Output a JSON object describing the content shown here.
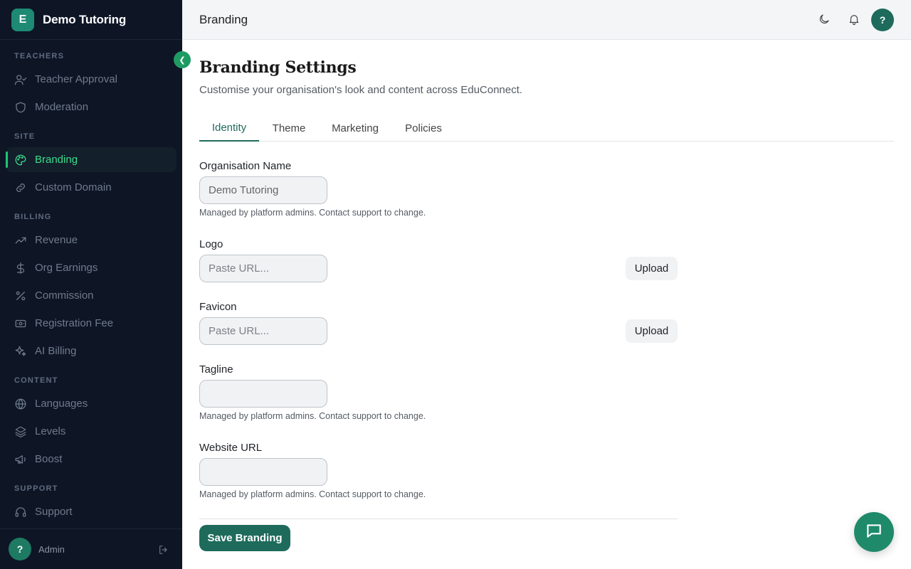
{
  "sidebar": {
    "brand_initial": "E",
    "brand_name": "Demo Tutoring",
    "sections": {
      "teachers": "TEACHERS",
      "site": "SITE",
      "billing": "BILLING",
      "content": "CONTENT",
      "support": "SUPPORT"
    },
    "items": {
      "teacher_approval": "Teacher Approval",
      "moderation": "Moderation",
      "branding": "Branding",
      "custom_domain": "Custom Domain",
      "revenue": "Revenue",
      "org_earnings": "Org Earnings",
      "commission": "Commission",
      "registration_fee": "Registration Fee",
      "ai_billing": "AI Billing",
      "languages": "Languages",
      "levels": "Levels",
      "boost": "Boost",
      "support": "Support"
    },
    "active_item": "Branding",
    "footer": {
      "avatar_initial": "?",
      "user": "Admin"
    }
  },
  "topbar": {
    "title": "Branding",
    "avatar_initial": "?"
  },
  "page": {
    "title": "Branding Settings",
    "subtitle": "Customise your organisation's look and content across EduConnect.",
    "tabs": [
      "Identity",
      "Theme",
      "Marketing",
      "Policies"
    ],
    "active_tab": "Identity"
  },
  "form": {
    "org_name": {
      "label": "Organisation Name",
      "value": "Demo Tutoring",
      "helper": "Managed by platform admins. Contact support to change."
    },
    "logo": {
      "label": "Logo",
      "placeholder": "Paste URL...",
      "button": "Upload"
    },
    "favicon": {
      "label": "Favicon",
      "placeholder": "Paste URL...",
      "button": "Upload"
    },
    "tagline": {
      "label": "Tagline",
      "value": "",
      "helper": "Managed by platform admins. Contact support to change."
    },
    "website": {
      "label": "Website URL",
      "value": "",
      "helper": "Managed by platform admins. Contact support to change."
    },
    "save_label": "Save Branding"
  },
  "colors": {
    "sidebar_bg": "#0e1626",
    "accent": "#1e6b5c",
    "active_nav": "#3ddc8f"
  },
  "icons": [
    "teacher-approval-icon",
    "shield-icon",
    "palette-icon",
    "link-icon",
    "trend-icon",
    "dollar-icon",
    "percent-icon",
    "ticket-icon",
    "sparkles-icon",
    "globe-icon",
    "layers-icon",
    "megaphone-icon",
    "headset-icon",
    "moon-icon",
    "bell-icon",
    "logout-icon",
    "chat-icon",
    "chevron-left-icon"
  ]
}
